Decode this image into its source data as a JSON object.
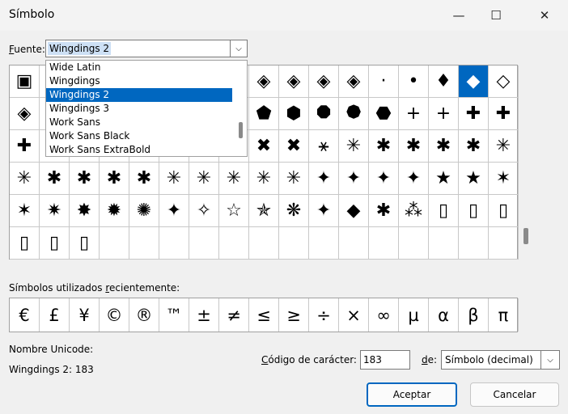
{
  "window": {
    "title": "Símbolo",
    "minimize_glyph": "—",
    "maximize_glyph": "☐",
    "close_glyph": "✕"
  },
  "font": {
    "label": "Fuente:",
    "label_mnemonic": "F",
    "label_rest": "uente:",
    "value": "Wingdings 2",
    "dropdown_arrow": "⌵"
  },
  "font_list": {
    "items": [
      "Wide Latin",
      "Wingdings",
      "Wingdings 2",
      "Wingdings 3",
      "Work Sans",
      "Work Sans Black",
      "Work Sans ExtraBold"
    ],
    "selected_index": 2
  },
  "symbols": {
    "rows": [
      [
        "▣",
        "",
        "",
        "",
        "",
        "",
        "",
        "",
        "◈",
        "◈",
        "◈",
        "◈",
        "·",
        "•",
        "♦",
        "◆",
        "◇"
      ],
      [
        "◈",
        "",
        "",
        "",
        "",
        "",
        "",
        "",
        "⬟",
        "⬢",
        "⯃",
        "⯄",
        "⬣",
        "+",
        "+",
        "✚",
        "✚"
      ],
      [
        "✚",
        "",
        "",
        "",
        "",
        "",
        "",
        "",
        "✖",
        "✖",
        "⚹",
        "✳",
        "✱",
        "✱",
        "✱",
        "✱",
        "✳"
      ],
      [
        "✳",
        "✱",
        "✱",
        "✱",
        "✱",
        "✳",
        "✳",
        "✳",
        "✳",
        "✳",
        "✦",
        "✦",
        "✦",
        "✦",
        "★",
        "★",
        "✶"
      ],
      [
        "✶",
        "✷",
        "✸",
        "✹",
        "✺",
        "✦",
        "✧",
        "☆",
        "✯",
        "❋",
        "✦",
        "◆",
        "✱",
        "⁂",
        "▯",
        "▯",
        "▯"
      ],
      [
        "▯",
        "▯",
        "▯",
        "",
        "",
        "",
        "",
        "",
        "",
        "",
        "",
        "",
        "",
        "",
        "",
        "",
        ""
      ]
    ],
    "selected": {
      "row": 0,
      "col": 15
    }
  },
  "recent": {
    "label": "Símbolos utilizados recientemente:",
    "label_pre": "Símbolos utilizados ",
    "label_mnemonic": "r",
    "label_post": "ecientemente:",
    "items": [
      "€",
      "£",
      "¥",
      "©",
      "®",
      "™",
      "±",
      "≠",
      "≤",
      "≥",
      "÷",
      "×",
      "∞",
      "µ",
      "α",
      "β",
      "π"
    ]
  },
  "unicode": {
    "name_label": "Nombre Unicode:",
    "name_value": "Wingdings 2: 183"
  },
  "char_code": {
    "label_mnemonic": "C",
    "label_rest": "ódigo de carácter:",
    "value": "183"
  },
  "from": {
    "label_mnemonic": "d",
    "label_rest": "e:",
    "value": "Símbolo (decimal)",
    "arrow": "⌵"
  },
  "buttons": {
    "ok": "Aceptar",
    "cancel": "Cancelar"
  }
}
